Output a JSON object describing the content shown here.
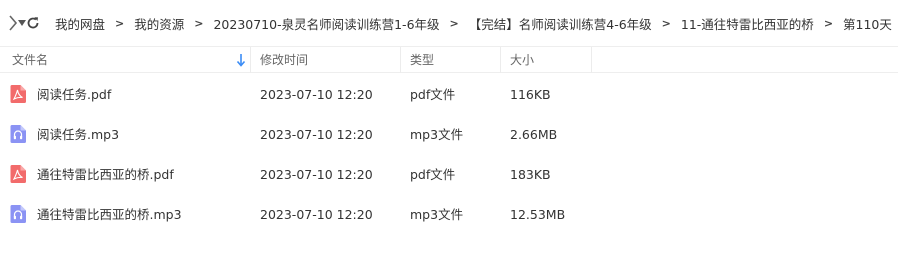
{
  "nav": {
    "back_icon": "chevron-left-icon",
    "dropdown_icon": "caret-down-icon",
    "refresh_icon": "refresh-icon",
    "breadcrumbs": [
      "我的网盘",
      "我的资源",
      "20230710-泉灵名师阅读训练营1-6年级",
      "【完结】名师阅读训练营4-6年级",
      "11-通往特雷比西亚的桥",
      "第110天"
    ],
    "separator": ">"
  },
  "columns": {
    "name": "文件名",
    "time": "修改时间",
    "type": "类型",
    "size": "大小"
  },
  "colors": {
    "pdf_icon": "#f26b6b",
    "mp3_icon": "#8b93f4",
    "sort_arrow": "#3b8cf5"
  },
  "files": [
    {
      "name": "阅读任务.pdf",
      "time": "2023-07-10 12:20",
      "type": "pdf文件",
      "size": "116KB",
      "icon": "pdf-icon"
    },
    {
      "name": "阅读任务.mp3",
      "time": "2023-07-10 12:20",
      "type": "mp3文件",
      "size": "2.66MB",
      "icon": "audio-file-icon"
    },
    {
      "name": "通往特雷比西亚的桥.pdf",
      "time": "2023-07-10 12:20",
      "type": "pdf文件",
      "size": "183KB",
      "icon": "pdf-icon"
    },
    {
      "name": "通往特雷比西亚的桥.mp3",
      "time": "2023-07-10 12:20",
      "type": "mp3文件",
      "size": "12.53MB",
      "icon": "audio-file-icon"
    }
  ]
}
